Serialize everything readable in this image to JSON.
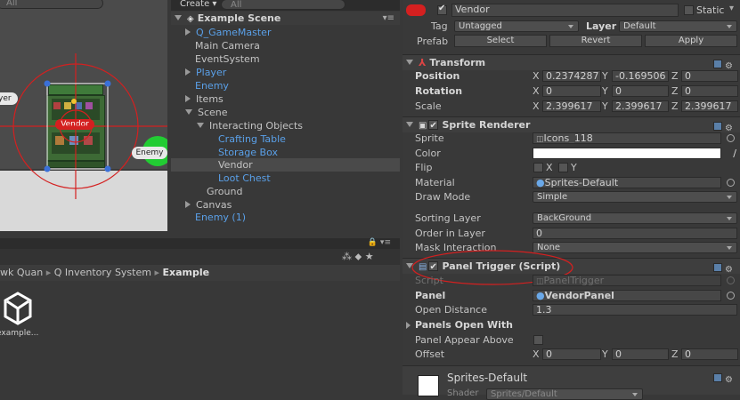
{
  "scene": {
    "search_placeholder": "All",
    "player_label": "yer",
    "vendor_label": "Vendor",
    "enemy_label": "Enemy"
  },
  "hierarchy": {
    "menu": "Create",
    "search_placeholder": "All",
    "scene_name": "Example Scene",
    "items": [
      {
        "label": "Q_GameMaster",
        "color": "blue"
      },
      {
        "label": "Main Camera",
        "color": "normal"
      },
      {
        "label": "EventSystem",
        "color": "normal"
      },
      {
        "label": "Player",
        "color": "blue"
      },
      {
        "label": "Enemy",
        "color": "blue"
      },
      {
        "label": "Items",
        "color": "normal"
      },
      {
        "label": "Scene",
        "color": "normal"
      },
      {
        "label": "Interacting Objects",
        "color": "normal"
      },
      {
        "label": "Crafting Table",
        "color": "blue"
      },
      {
        "label": "Storage Box",
        "color": "blue"
      },
      {
        "label": "Vendor",
        "color": "normal"
      },
      {
        "label": "Loot Chest",
        "color": "blue"
      },
      {
        "label": "Ground",
        "color": "normal"
      },
      {
        "label": "Canvas",
        "color": "normal"
      },
      {
        "label": "Enemy (1)",
        "color": "blue"
      }
    ]
  },
  "project": {
    "breadcrumb": [
      "wk Quan",
      "Q Inventory System",
      "Example"
    ],
    "asset_label": "example..."
  },
  "inspector": {
    "object_name": "Vendor",
    "static_label": "Static",
    "tag_label": "Tag",
    "tag_value": "Untagged",
    "layer_label": "Layer",
    "layer_value": "Default",
    "prefab_label": "Prefab",
    "prefab_buttons": [
      "Select",
      "Revert",
      "Apply"
    ],
    "transform": {
      "title": "Transform",
      "position_label": "Position",
      "rotation_label": "Rotation",
      "scale_label": "Scale",
      "position": {
        "x": "0.2374287",
        "y": "-0.169506",
        "z": "0"
      },
      "rotation": {
        "x": "0",
        "y": "0",
        "z": "0"
      },
      "scale": {
        "x": "2.399617",
        "y": "2.399617",
        "z": "2.399617"
      }
    },
    "sprite_renderer": {
      "title": "Sprite Renderer",
      "sprite_label": "Sprite",
      "sprite_value": "Icons_118",
      "color_label": "Color",
      "flip_label": "Flip",
      "material_label": "Material",
      "material_value": "Sprites-Default",
      "draw_mode_label": "Draw Mode",
      "draw_mode_value": "Simple",
      "sorting_layer_label": "Sorting Layer",
      "sorting_layer_value": "BackGround",
      "order_label": "Order in Layer",
      "order_value": "0",
      "mask_label": "Mask Interaction",
      "mask_value": "None"
    },
    "panel_trigger": {
      "title": "Panel Trigger (Script)",
      "script_label": "Script",
      "script_value": "PanelTrigger",
      "panel_label": "Panel",
      "panel_value": "VendorPanel",
      "open_distance_label": "Open Distance",
      "open_distance_value": "1.3",
      "panels_open_with_label": "Panels Open With",
      "panel_appear_above_label": "Panel Appear Above",
      "offset_label": "Offset",
      "offset": {
        "x": "0",
        "y": "0",
        "z": "0"
      }
    },
    "material_preview": {
      "name": "Sprites-Default",
      "shader_label": "Shader",
      "shader_value": "Sprites/Default"
    }
  },
  "colors": {
    "accent_red": "#d42020",
    "link_blue": "#5aa0e8",
    "enemy_green": "#22cc33"
  }
}
